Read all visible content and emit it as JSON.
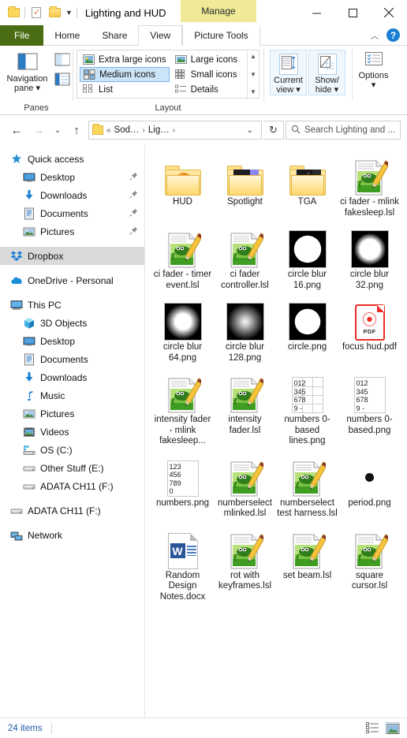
{
  "window": {
    "title": "Lighting and HUD",
    "contextual_tab_group": "Manage",
    "minimize": "—",
    "maximize": "□",
    "close": "✕"
  },
  "ribbon": {
    "tabs": [
      {
        "label": "File",
        "state": "file"
      },
      {
        "label": "Home",
        "state": "normal"
      },
      {
        "label": "Share",
        "state": "normal"
      },
      {
        "label": "View",
        "state": "active"
      },
      {
        "label": "Picture Tools",
        "state": "contextual"
      }
    ],
    "collapse_caret": "︿",
    "help_label": "?",
    "groups": {
      "panes": {
        "label": "Panes",
        "navigation_pane": "Navigation\npane",
        "navigation_pane_line1": "Navigation",
        "navigation_pane_line2": "pane",
        "caret": "▾"
      },
      "layout": {
        "label": "Layout",
        "options": [
          {
            "label": "Extra large icons",
            "selected": false
          },
          {
            "label": "Large icons",
            "selected": false
          },
          {
            "label": "Medium icons",
            "selected": true
          },
          {
            "label": "Small icons",
            "selected": false
          },
          {
            "label": "List",
            "selected": false
          },
          {
            "label": "Details",
            "selected": false
          }
        ],
        "scroll_up": "▲",
        "scroll_down": "▼",
        "scroll_more": "▼"
      },
      "view_controls": {
        "current_view_line1": "Current",
        "current_view_line2": "view",
        "show_hide_line1": "Show/",
        "show_hide_line2": "hide",
        "options_label": "Options",
        "caret": "▾"
      }
    }
  },
  "addressbar": {
    "back": "←",
    "forward": "→",
    "recent_caret": "⌄",
    "up": "↑",
    "crumbs": [
      "«",
      "Sod…",
      "›",
      "Lig…",
      "›"
    ],
    "dropdown_caret": "⌄",
    "refresh": "↻",
    "search_placeholder": "Search Lighting and ...",
    "search_value": ""
  },
  "sidebar": {
    "items": [
      {
        "label": "Quick access",
        "icon": "star-pin-icon",
        "indent": 0,
        "pinned": false,
        "selected": false
      },
      {
        "label": "Desktop",
        "icon": "desktop-icon",
        "indent": 1,
        "pinned": true,
        "selected": false
      },
      {
        "label": "Downloads",
        "icon": "download-icon",
        "indent": 1,
        "pinned": true,
        "selected": false
      },
      {
        "label": "Documents",
        "icon": "documents-icon",
        "indent": 1,
        "pinned": true,
        "selected": false
      },
      {
        "label": "Pictures",
        "icon": "pictures-icon",
        "indent": 1,
        "pinned": true,
        "selected": false
      },
      {
        "label": "Dropbox",
        "icon": "dropbox-icon",
        "indent": 0,
        "pinned": false,
        "selected": true
      },
      {
        "label": "OneDrive - Personal",
        "icon": "onedrive-icon",
        "indent": 0,
        "pinned": false,
        "selected": false
      },
      {
        "label": "This PC",
        "icon": "thispc-icon",
        "indent": 0,
        "pinned": false,
        "selected": false
      },
      {
        "label": "3D Objects",
        "icon": "3dobjects-icon",
        "indent": 1,
        "pinned": false,
        "selected": false
      },
      {
        "label": "Desktop",
        "icon": "desktop-icon",
        "indent": 1,
        "pinned": false,
        "selected": false
      },
      {
        "label": "Documents",
        "icon": "documents-icon",
        "indent": 1,
        "pinned": false,
        "selected": false
      },
      {
        "label": "Downloads",
        "icon": "download-icon",
        "indent": 1,
        "pinned": false,
        "selected": false
      },
      {
        "label": "Music",
        "icon": "music-icon",
        "indent": 1,
        "pinned": false,
        "selected": false
      },
      {
        "label": "Pictures",
        "icon": "pictures-icon",
        "indent": 1,
        "pinned": false,
        "selected": false
      },
      {
        "label": "Videos",
        "icon": "videos-icon",
        "indent": 1,
        "pinned": false,
        "selected": false
      },
      {
        "label": "OS (C:)",
        "icon": "drive-os-icon",
        "indent": 1,
        "pinned": false,
        "selected": false
      },
      {
        "label": "Other Stuff (E:)",
        "icon": "drive-icon",
        "indent": 1,
        "pinned": false,
        "selected": false
      },
      {
        "label": "ADATA CH11 (F:)",
        "icon": "drive-icon",
        "indent": 1,
        "pinned": false,
        "selected": false
      },
      {
        "label": "ADATA CH11 (F:)",
        "icon": "drive-icon",
        "indent": 0,
        "pinned": false,
        "selected": false
      },
      {
        "label": "Network",
        "icon": "network-icon",
        "indent": 0,
        "pinned": false,
        "selected": false
      }
    ]
  },
  "files": [
    {
      "name": "HUD",
      "type": "folder-hud"
    },
    {
      "name": "Spotlight",
      "type": "folder-spotlight"
    },
    {
      "name": "TGA",
      "type": "folder-tga"
    },
    {
      "name": "ci fader - mlink fakesleep.lsl",
      "type": "lsl"
    },
    {
      "name": "ci fader - timer event.lsl",
      "type": "lsl"
    },
    {
      "name": "ci fader controller.lsl",
      "type": "lsl"
    },
    {
      "name": "circle blur 16.png",
      "type": "png-circle-sharp"
    },
    {
      "name": "circle blur 32.png",
      "type": "png-circle-blur1"
    },
    {
      "name": "circle blur 64.png",
      "type": "png-circle-blur2"
    },
    {
      "name": "circle blur 128.png",
      "type": "png-circle-blur3"
    },
    {
      "name": "circle.png",
      "type": "png-circle-hard"
    },
    {
      "name": "focus hud.pdf",
      "type": "pdf"
    },
    {
      "name": "intensity fader - mlink fakesleep...",
      "type": "lsl"
    },
    {
      "name": "intensity fader.lsl",
      "type": "lsl"
    },
    {
      "name": "numbers 0-based lines.png",
      "type": "png-numbers-lines"
    },
    {
      "name": "numbers 0-based.png",
      "type": "png-numbers"
    },
    {
      "name": "numbers.png",
      "type": "png-numbers-1"
    },
    {
      "name": "numberselect mlinked.lsl",
      "type": "lsl"
    },
    {
      "name": "numberselect test harness.lsl",
      "type": "lsl"
    },
    {
      "name": "period.png",
      "type": "png-period"
    },
    {
      "name": "Random Design Notes.docx",
      "type": "docx"
    },
    {
      "name": "rot with keyframes.lsl",
      "type": "lsl"
    },
    {
      "name": "set beam.lsl",
      "type": "lsl"
    },
    {
      "name": "square cursor.lsl",
      "type": "lsl"
    }
  ],
  "thumb_text": {
    "numbers_0based": [
      "012",
      "345",
      "678",
      "9 -"
    ],
    "numbers_1based": [
      "123",
      "456",
      "789",
      "0"
    ]
  },
  "statusbar": {
    "item_count": "24 items",
    "details_view_icon": "details-view-icon",
    "thumbnail_view_icon": "large-icons-view-icon"
  },
  "colors": {
    "file_tab": "#4a6d14",
    "contextual": "#f0ea96",
    "selection": "#cce4f7",
    "status_text": "#1e5aa8"
  }
}
